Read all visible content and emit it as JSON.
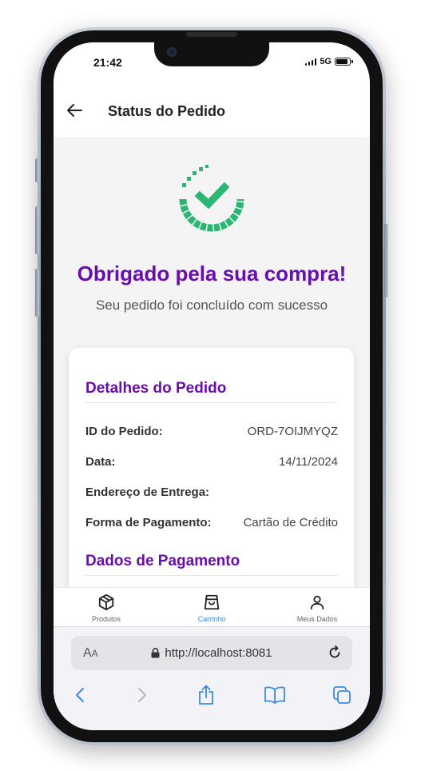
{
  "status_bar": {
    "time": "21:42",
    "network": "5G"
  },
  "header": {
    "title": "Status do Pedido",
    "back_icon": "arrow-left-icon"
  },
  "success": {
    "title": "Obrigado pela sua compra!",
    "subtitle": "Seu pedido foi concluído com sucesso"
  },
  "order_details": {
    "heading": "Detalhes do Pedido",
    "rows": [
      {
        "label": "ID do Pedido:",
        "value": "ORD-7OIJMYQZ"
      },
      {
        "label": "Data:",
        "value": "14/11/2024"
      },
      {
        "label": "Endereço de Entrega:",
        "value": ""
      },
      {
        "label": "Forma de Pagamento:",
        "value": "Cartão de Crédito"
      }
    ]
  },
  "payment_details": {
    "heading": "Dados de Pagamento"
  },
  "tabbar": {
    "tabs": [
      {
        "label": "Produtos",
        "icon": "box-icon",
        "active": false
      },
      {
        "label": "Carrinho",
        "icon": "shopping-bag-icon",
        "active": true
      },
      {
        "label": "Meus Dados",
        "icon": "user-icon",
        "active": false
      }
    ]
  },
  "browser": {
    "aa_label": "AA",
    "url": "http://localhost:8081"
  },
  "colors": {
    "accent": "#6a0dad",
    "success": "#2bb673",
    "link": "#3a8be6"
  }
}
